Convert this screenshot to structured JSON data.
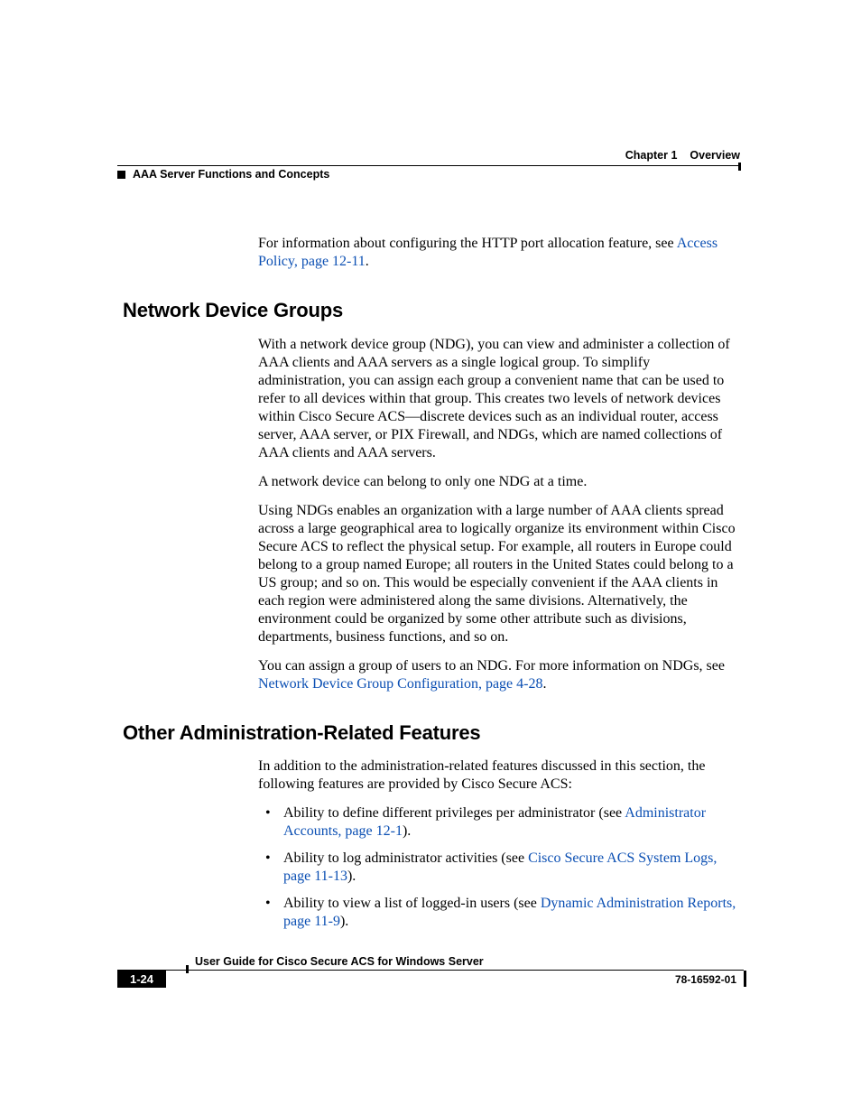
{
  "header": {
    "chapter_label": "Chapter 1",
    "chapter_title": "Overview",
    "section_title": "AAA Server Functions and Concepts"
  },
  "intro": {
    "para1_pre": "For information about configuring the HTTP port allocation feature, see ",
    "para1_link": "Access Policy, page 12-11",
    "para1_post": "."
  },
  "ndg": {
    "heading": "Network Device Groups",
    "p1": "With a network device group (NDG), you can view and administer a collection of AAA clients and AAA servers as a single logical group. To simplify administration, you can assign each group a convenient name that can be used to refer to all devices within that group. This creates two levels of network devices within Cisco Secure ACS—discrete devices such as an individual router, access server, AAA server, or PIX Firewall, and NDGs, which are named collections of AAA clients and AAA servers.",
    "p2": "A network device can belong to only one NDG at a time.",
    "p3": "Using NDGs enables an organization with a large number of AAA clients spread across a large geographical area to logically organize its environment within Cisco Secure ACS to reflect the physical setup. For example, all routers in Europe could belong to a group named Europe; all routers in the United States could belong to a US group; and so on. This would be especially convenient if the AAA clients in each region were administered along the same divisions. Alternatively, the environment could be organized by some other attribute such as divisions, departments, business functions, and so on.",
    "p4_pre": "You can assign a group of users to an NDG. For more information on NDGs, see ",
    "p4_link": "Network Device Group Configuration, page 4-28",
    "p4_post": "."
  },
  "other": {
    "heading": "Other Administration-Related Features",
    "p1": "In addition to the administration-related features discussed in this section, the following features are provided by Cisco Secure ACS:",
    "bullets": [
      {
        "pre": "Ability to define different privileges per administrator (see ",
        "link": "Administrator Accounts, page 12-1",
        "post": ")."
      },
      {
        "pre": "Ability to log administrator activities (see ",
        "link": "Cisco Secure ACS System Logs, page 11-13",
        "post": ")."
      },
      {
        "pre": "Ability to view a list of logged-in users (see ",
        "link": "Dynamic Administration Reports, page 11-9",
        "post": ")."
      }
    ]
  },
  "footer": {
    "doc_title": "User Guide for Cisco Secure ACS for Windows Server",
    "page_number": "1-24",
    "doc_number": "78-16592-01"
  }
}
